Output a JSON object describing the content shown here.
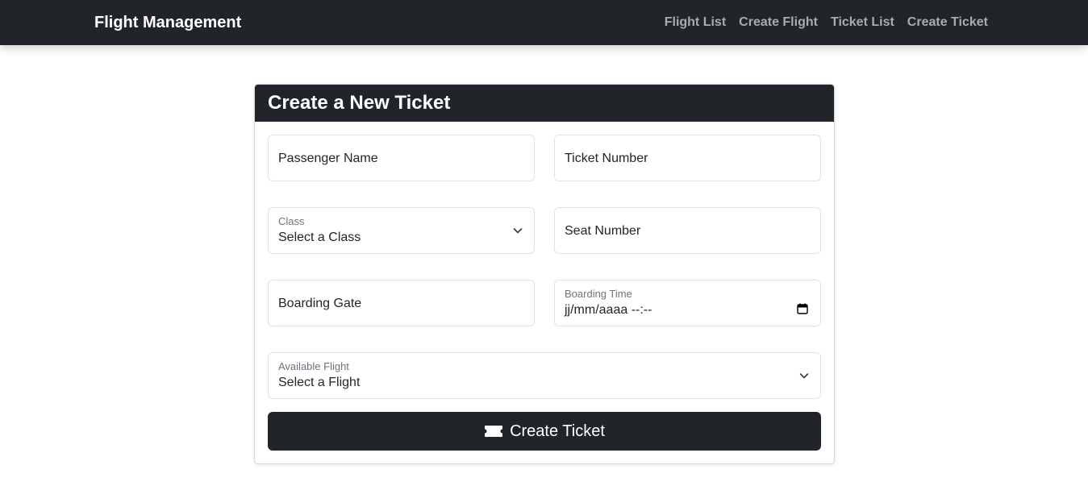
{
  "navbar": {
    "brand": "Flight Management",
    "links": [
      "Flight List",
      "Create Flight",
      "Ticket List",
      "Create Ticket"
    ]
  },
  "form": {
    "title": "Create a New Ticket",
    "passenger_name_placeholder": "Passenger Name",
    "ticket_number_placeholder": "Ticket Number",
    "class_label": "Class",
    "class_value": "Select a Class",
    "seat_number_placeholder": "Seat Number",
    "boarding_gate_placeholder": "Boarding Gate",
    "boarding_time_label": "Boarding Time",
    "boarding_time_value": "jj/mm/aaaa --:--",
    "flight_label": "Available Flight",
    "flight_value": "Select a Flight",
    "submit_label": "Create Ticket"
  },
  "colors": {
    "navbar_bg": "#212529",
    "nav_link": "#a9acaf",
    "accent": "#212529"
  },
  "icons": {
    "submit": "ticket-icon",
    "select": "chevron-down-icon",
    "datetime": "calendar-icon"
  }
}
